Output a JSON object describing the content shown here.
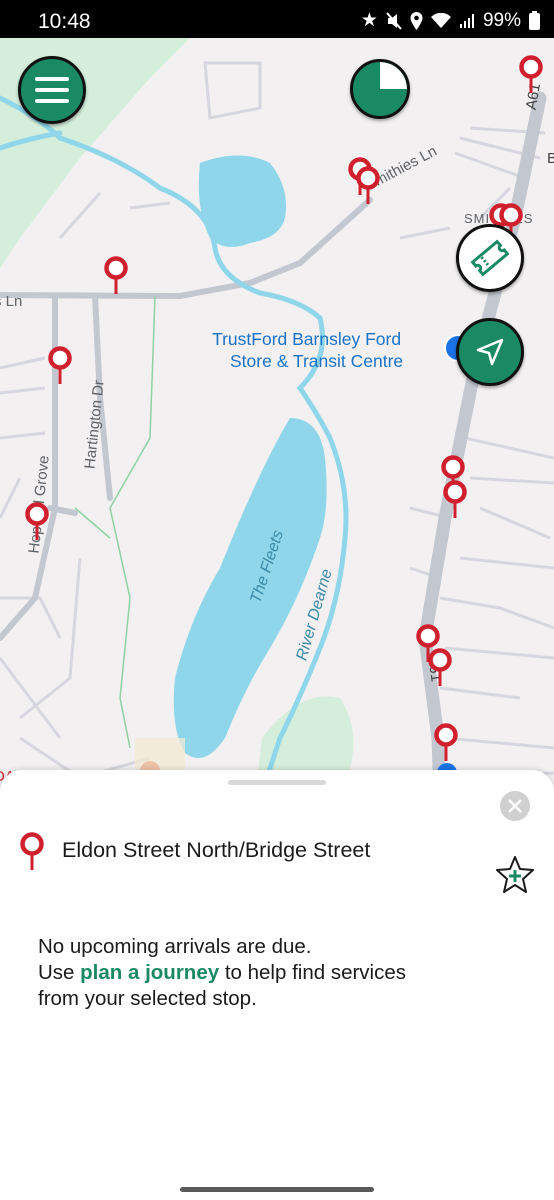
{
  "status_bar": {
    "time": "10:48",
    "battery": "99%"
  },
  "map": {
    "labels": {
      "smithies_ln": "Smithies Ln",
      "ln_left": "s Ln",
      "hartington": "Hartington Dr",
      "hopwell": "Hopwell Grove",
      "fleets": "The Fleets",
      "river": "River Dearne",
      "a61_top": "A61",
      "a61_mid": "A61",
      "smithies_area": "SMITHIES",
      "b_edge": "B",
      "da_edge": "DA"
    },
    "poi": {
      "line1": "TrustFord Barnsley Ford",
      "line2": "Store & Transit Centre"
    }
  },
  "controls": {
    "menu_icon": "hamburger-icon",
    "timer_icon": "refresh-timer-icon",
    "ticket_icon": "ticket-icon",
    "locate_icon": "navigation-arrow-icon"
  },
  "sheet": {
    "stop_name": "Eldon Street North/Bridge Street",
    "message_line1": "No upcoming arrivals are due.",
    "message_use": "Use ",
    "message_link": "plan a journey",
    "message_after": " to help find services",
    "message_line3": "from your selected stop."
  },
  "colors": {
    "brand_green": "#1a8a65",
    "pin_red": "#d0202e",
    "water": "#8fd6ea",
    "park": "#d5eedb"
  }
}
